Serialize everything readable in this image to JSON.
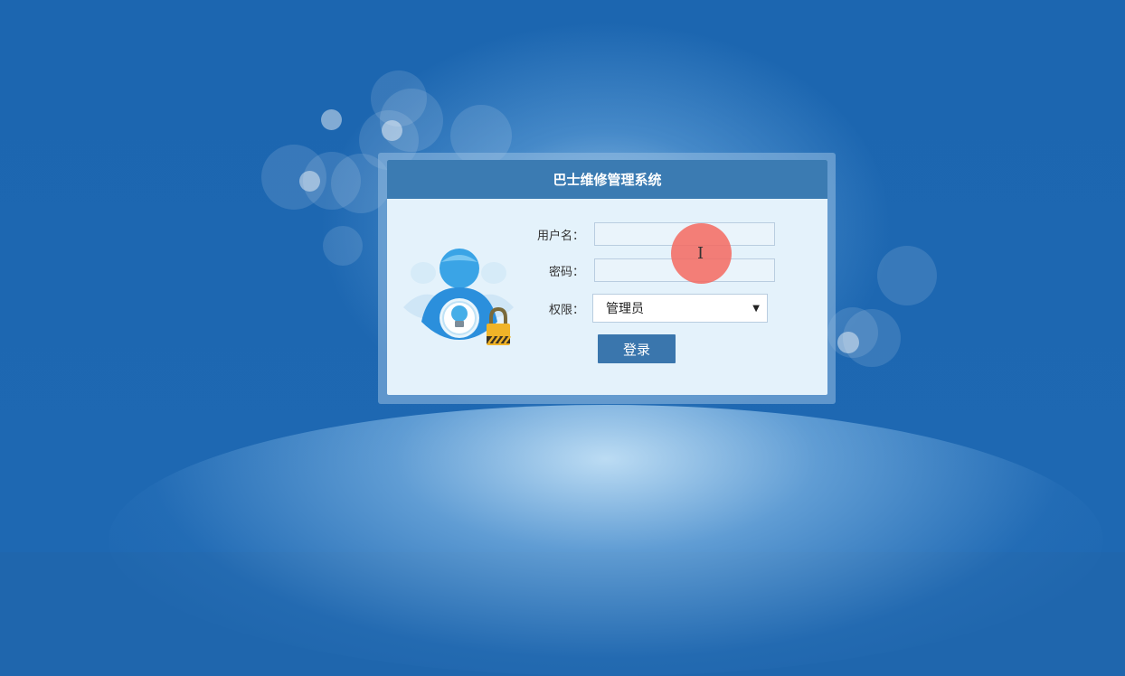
{
  "app": {
    "title": "巴士维修管理系统"
  },
  "form": {
    "username_label": "用户名：",
    "username_value": "",
    "password_label": "密码：",
    "password_value": "",
    "role_label": "权限：",
    "role_selected": "管理员",
    "submit_label": "登录"
  },
  "icons": {
    "avatar": "user-lock-icon",
    "select_arrow": "▼",
    "cursor": "text-cursor-icon",
    "cursor_glyph": "I"
  },
  "colors": {
    "background": "#1f66ad",
    "header": "#3b7bb2",
    "button": "#3a76ad",
    "panel": "#e4f2fb",
    "cursor_highlight": "#f5695f"
  }
}
